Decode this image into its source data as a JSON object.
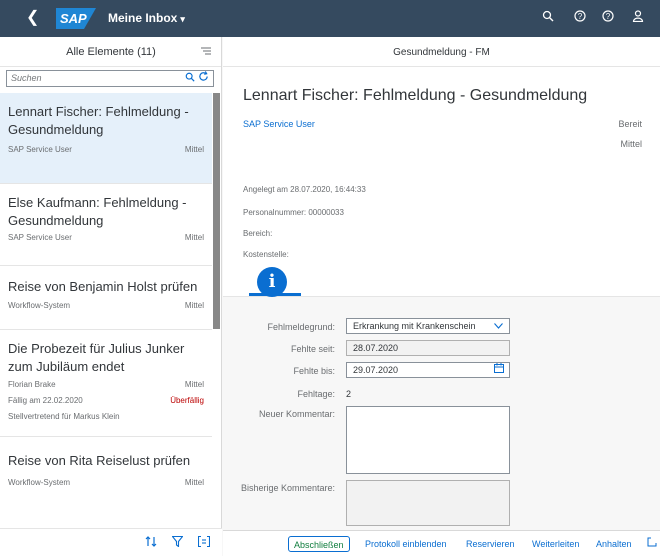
{
  "shell": {
    "back_icon": "chevron-left-icon",
    "logo": "SAP",
    "title": "Meine Inbox",
    "title_caret": "▾",
    "icons": [
      "search-icon",
      "help-icon",
      "help-icon",
      "user-icon"
    ]
  },
  "master": {
    "title": "Alle Elemente (11)",
    "search_placeholder": "Suchen",
    "items": [
      {
        "title": "Lennart Fischer: Fehlmeldung - Gesundmeldung",
        "left": "SAP Service User",
        "right": "Mittel"
      },
      {
        "title": "Else Kaufmann: Fehlmeldung - Gesundmeldung",
        "left": "SAP Service User",
        "right": "Mittel"
      },
      {
        "title": "Reise von Benjamin Holst prüfen",
        "left": "Workflow-System",
        "right": "Mittel"
      },
      {
        "title": "Die Probezeit für Julius Junker zum Jubiläum endet",
        "left": "Florian Brake",
        "right": "Mittel",
        "line2_left": "Fällig am 22.02.2020",
        "line2_right": "Überfällig",
        "line3": "Stellvertretend für Markus Klein"
      },
      {
        "title": "Reise von Rita Reiselust prüfen",
        "left": "Workflow-System",
        "right": "Mittel"
      }
    ]
  },
  "detail": {
    "header": "Gesundmeldung - FM",
    "object_title": "Lennart Fischer: Fehlmeldung - Gesundmeldung",
    "created_by": "SAP Service User",
    "status": "Bereit",
    "priority": "Mittel",
    "attributes": [
      "Angelegt am 28.07.2020, 16:44:33",
      "Personalnummer: 00000033",
      "Bereich:",
      "Kostenstelle:"
    ],
    "tab_icon": "information-icon",
    "form": {
      "reason_label": "Fehlmeldegrund:",
      "reason_value": "Erkrankung mit Krankenschein",
      "from_label": "Fehlte seit:",
      "from_value": "28.07.2020",
      "to_label": "Fehlte bis:",
      "to_value": "29.07.2020",
      "days_label": "Fehltage:",
      "days_value": "2",
      "comment_label": "Neuer Kommentar:",
      "prev_label": "Bisherige Kommentare:"
    },
    "footer": {
      "complete": "Abschließen",
      "show_log": "Protokoll einblenden",
      "reserve": "Reservieren",
      "forward": "Weiterleiten",
      "suspend": "Anhalten"
    }
  },
  "colors": {
    "shell": "#354a5f",
    "accent": "#0a6ed1",
    "selected": "#e5f0fa",
    "error": "#bb0000"
  }
}
